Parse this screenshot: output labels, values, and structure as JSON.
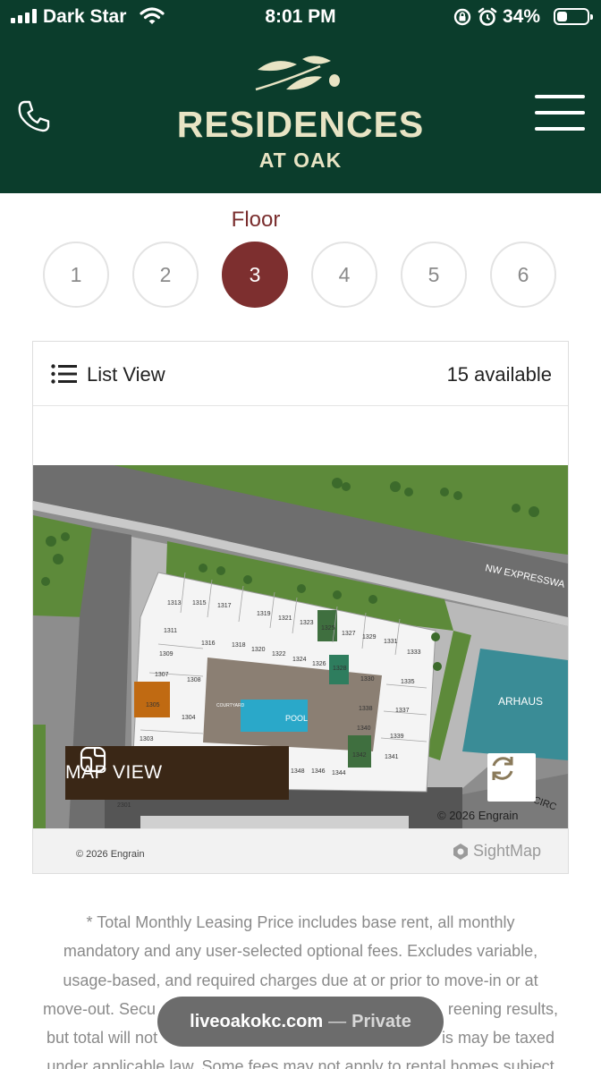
{
  "status_bar": {
    "carrier": "Dark Star",
    "time": "8:01 PM",
    "battery_percent": "34%",
    "battery_level": 0.34,
    "icons": [
      "signal-icon",
      "wifi-icon",
      "rotation-lock-icon",
      "alarm-icon",
      "battery-icon"
    ]
  },
  "header": {
    "brand_line1": "RESIDENCES",
    "brand_line2": "AT OAK",
    "colors": {
      "background": "#0b3d2c",
      "brand_text": "#e8e4c4"
    }
  },
  "floor_selector": {
    "label": "Floor",
    "floors": [
      "1",
      "2",
      "3",
      "4",
      "5",
      "6"
    ],
    "selected": "3",
    "active_color": "#7d2f2f"
  },
  "map_card": {
    "list_view_label": "List View",
    "available_text": "15 available",
    "map_view_label": "MAP VIEW",
    "map_copyright": "© 2026 Engrain",
    "footer_copyright": "© 2026 Engrain",
    "sightmap_label": "SightMap",
    "map": {
      "road_label": "NW EXPRESSWA",
      "road_label2": "OD CIRC",
      "store_label": "ARHAUS",
      "pool_label": "POOL",
      "courtyard_label": "COURTYARD",
      "units": [
        "1313",
        "1315",
        "1317",
        "1319",
        "1321",
        "1323",
        "1325",
        "1327",
        "1329",
        "1331",
        "1333",
        "1311",
        "1316",
        "1318",
        "1320",
        "1322",
        "1324",
        "1326",
        "1328",
        "1330",
        "1335",
        "1309",
        "1307",
        "1308",
        "1337",
        "1338",
        "1305",
        "1304",
        "1340",
        "1339",
        "1303",
        "1342",
        "1341",
        "1348",
        "1346",
        "1344",
        "2301"
      ],
      "highlight_unit": "1305",
      "highlight_color": "#c06a12"
    }
  },
  "disclaimer": {
    "line1": "* Total Monthly Leasing Price includes base rent, all monthly",
    "line2": "mandatory and any user-selected optional fees. Excludes variable,",
    "line3": "usage-based, and required charges due at or prior to move-in or at",
    "line4_start": "move-out. Secu",
    "line4_end": "reening results,",
    "line5_start": "but total will not",
    "line5_end": "is may be taxed",
    "line6": "under applicable law. Some fees may not apply to rental homes subject"
  },
  "url_bar": {
    "domain": "liveoakokc.com",
    "separator": "—",
    "mode": "Private"
  }
}
